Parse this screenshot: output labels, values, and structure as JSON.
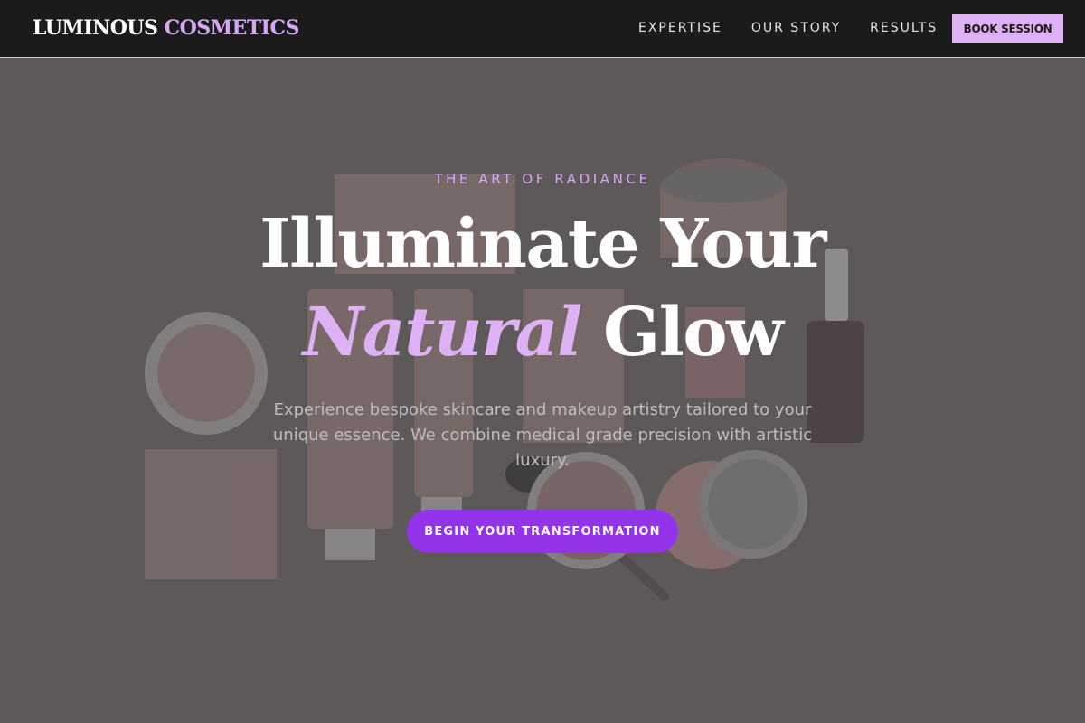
{
  "brand": {
    "name": "LUMINOUS",
    "accent": "COSMETICS"
  },
  "nav": {
    "links": [
      "EXPERTISE",
      "OUR STORY",
      "RESULTS"
    ],
    "book_label": "BOOK SESSION"
  },
  "hero": {
    "eyebrow": "THE ART OF RADIANCE",
    "headline_line1": "Illuminate Your",
    "headline_accent": "Natural",
    "headline_end": "Glow",
    "subtext": "Experience bespoke skincare and makeup artistry tailored to your unique essence. We combine medical grade precision with artistic luxury.",
    "cta_label": "BEGIN YOUR TRANSFORMATION"
  },
  "colors": {
    "nav_bg": "#1b1b1b",
    "accent": "#d6a8f3",
    "cta": "#9333ea",
    "hero_overlay": "#5f5959"
  }
}
